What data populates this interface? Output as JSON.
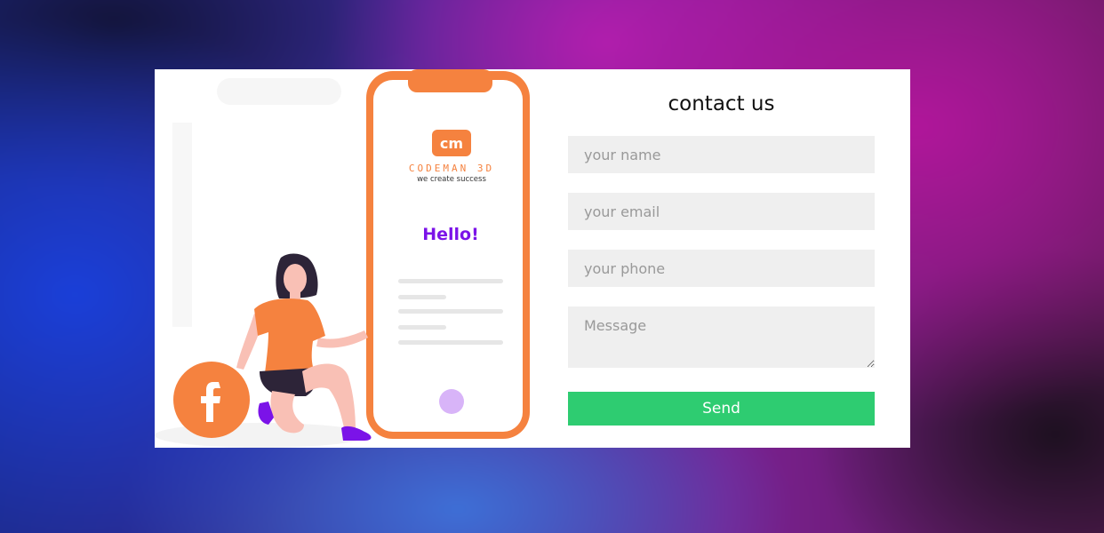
{
  "contact_form": {
    "title": "contact us",
    "name_placeholder": "your name",
    "email_placeholder": "your email",
    "phone_placeholder": "your phone",
    "message_placeholder": "Message",
    "send_label": "Send"
  },
  "illustration": {
    "logo_monogram": "cm",
    "logo_wordmark": "CODEMAN 3D",
    "logo_tagline": "we create success",
    "greeting": "Hello!",
    "social_icon": "facebook-icon"
  },
  "colors": {
    "accent_orange": "#f5823f",
    "greeting_purple": "#7b13e8",
    "send_green": "#2ecc71",
    "field_gray": "#efefef"
  }
}
